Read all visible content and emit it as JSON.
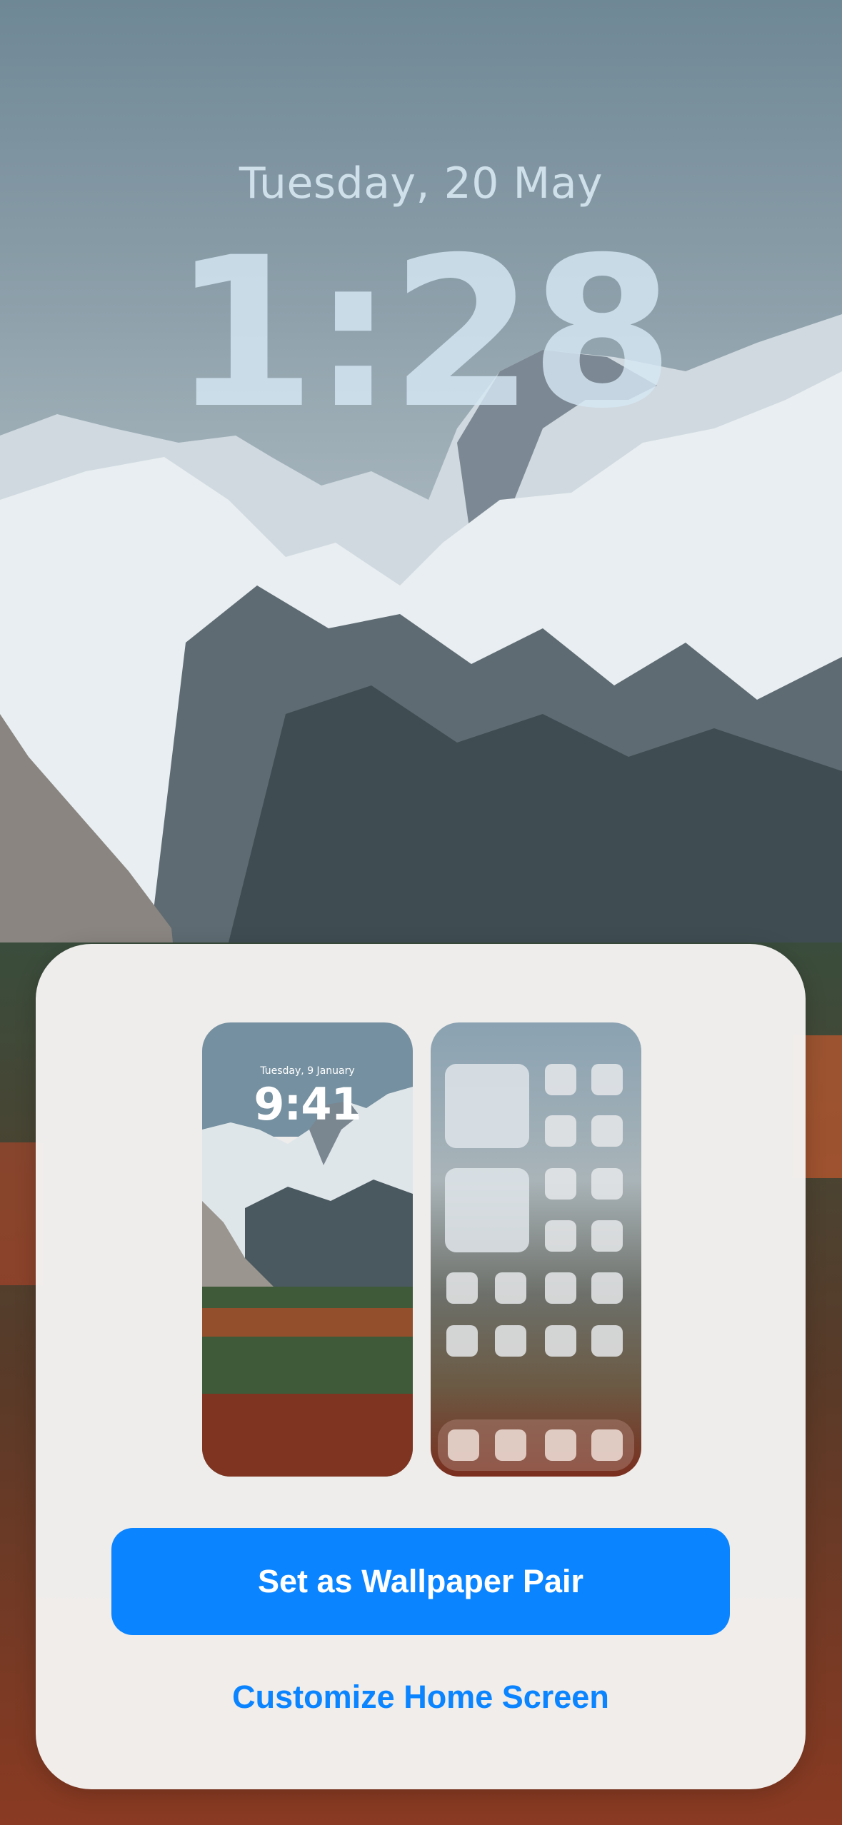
{
  "lock_screen": {
    "date": "Tuesday, 20 May",
    "time": "1:28"
  },
  "sheet": {
    "lock_preview": {
      "date": "Tuesday, 9 January",
      "time": "9:41"
    },
    "primary_button_label": "Set as Wallpaper Pair",
    "secondary_button_label": "Customize Home Screen"
  },
  "colors": {
    "accent": "#0a84ff",
    "sheet_background": "#f4f3f2"
  }
}
